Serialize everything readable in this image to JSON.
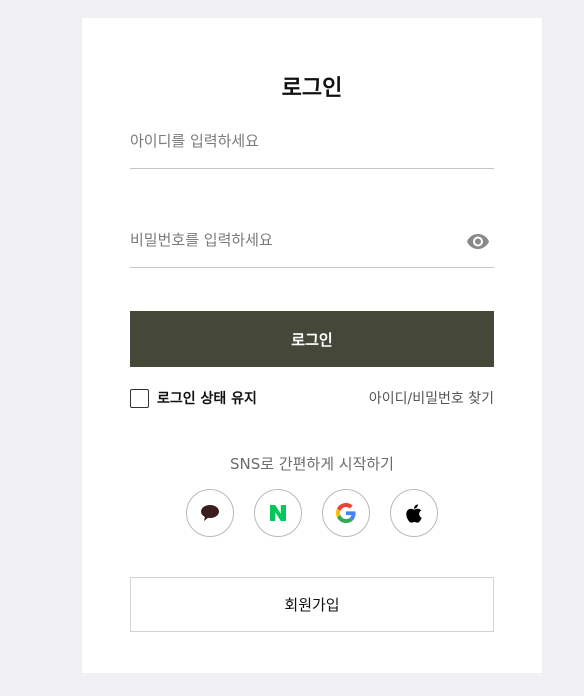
{
  "login": {
    "title": "로그인",
    "id_placeholder": "아이디를 입력하세요",
    "id_value": "",
    "pw_placeholder": "비밀번호를 입력하세요",
    "pw_value": "",
    "submit_label": "로그인",
    "remember_label": "로그인 상태 유지",
    "remember_checked": false,
    "find_label": "아이디/비밀번호 찾기",
    "sns_title": "SNS로 간편하게 시작하기",
    "sns_buttons": [
      {
        "icon": "kakao-speech-bubble-icon",
        "color": "#3b1e1e"
      },
      {
        "icon": "naver-n-icon",
        "color": "#03c75a"
      },
      {
        "icon": "google-g-icon",
        "color": "#4285f4"
      },
      {
        "icon": "apple-icon",
        "color": "#000000"
      }
    ],
    "signup_label": "회원가입"
  },
  "colors": {
    "page_bg": "#efeff4",
    "card_bg": "#ffffff",
    "primary_button": "#454839"
  }
}
